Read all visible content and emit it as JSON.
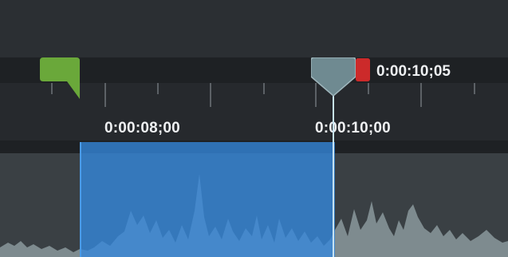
{
  "timeline": {
    "current_time": "0:00:10;05",
    "ruler_labels": [
      "0:00:08;00",
      "0:00:10;00"
    ]
  },
  "colors": {
    "selection": "#3488dc",
    "playhead": "#6f8a91",
    "in_marker": "#6aa83a",
    "out_marker": "#cc2a2a",
    "waveform": "#7e8b8f"
  },
  "icons": {
    "in_point": "green-flag-icon",
    "playhead": "playhead-icon",
    "out_point": "red-marker-icon"
  }
}
